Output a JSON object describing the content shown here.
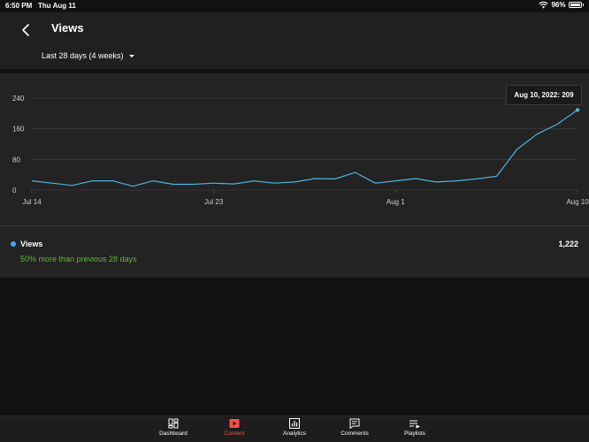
{
  "status_bar": {
    "time": "6:50 PM",
    "date": "Thu Aug 11",
    "battery": "96%"
  },
  "header": {
    "title": "Views",
    "range_label": "Last 28 days (4 weeks)"
  },
  "chart_data": {
    "type": "line",
    "x": [
      "Jul 14",
      "Jul 15",
      "Jul 16",
      "Jul 17",
      "Jul 18",
      "Jul 19",
      "Jul 20",
      "Jul 21",
      "Jul 22",
      "Jul 23",
      "Jul 24",
      "Jul 25",
      "Jul 26",
      "Jul 27",
      "Jul 28",
      "Jul 29",
      "Jul 30",
      "Jul 31",
      "Aug 1",
      "Aug 2",
      "Aug 3",
      "Aug 4",
      "Aug 5",
      "Aug 6",
      "Aug 7",
      "Aug 8",
      "Aug 9",
      "Aug 10"
    ],
    "values": [
      24,
      18,
      12,
      24,
      24,
      10,
      24,
      15,
      15,
      18,
      16,
      24,
      18,
      21,
      30,
      29,
      46,
      18,
      24,
      30,
      21,
      24,
      29,
      36,
      106,
      146,
      172,
      209
    ],
    "yticks": [
      0,
      80,
      160,
      240
    ],
    "ylim": [
      0,
      240
    ],
    "xtick_labels": [
      "Jul 14",
      "Jul 23",
      "Aug 1",
      "Aug 10"
    ],
    "series_name": "Views",
    "color": "#4fb3e0",
    "tooltip": "Aug 10, 2022: 209"
  },
  "summary": {
    "label": "Views",
    "total": "1,222",
    "comparison": "50% more than previous 28 days"
  },
  "nav": [
    {
      "label": "Dashboard",
      "icon": "dashboard-icon",
      "active": false
    },
    {
      "label": "Content",
      "icon": "content-icon",
      "active": true
    },
    {
      "label": "Analytics",
      "icon": "analytics-icon",
      "active": false
    },
    {
      "label": "Comments",
      "icon": "comments-icon",
      "active": false
    },
    {
      "label": "Playlists",
      "icon": "playlists-icon",
      "active": false
    }
  ]
}
